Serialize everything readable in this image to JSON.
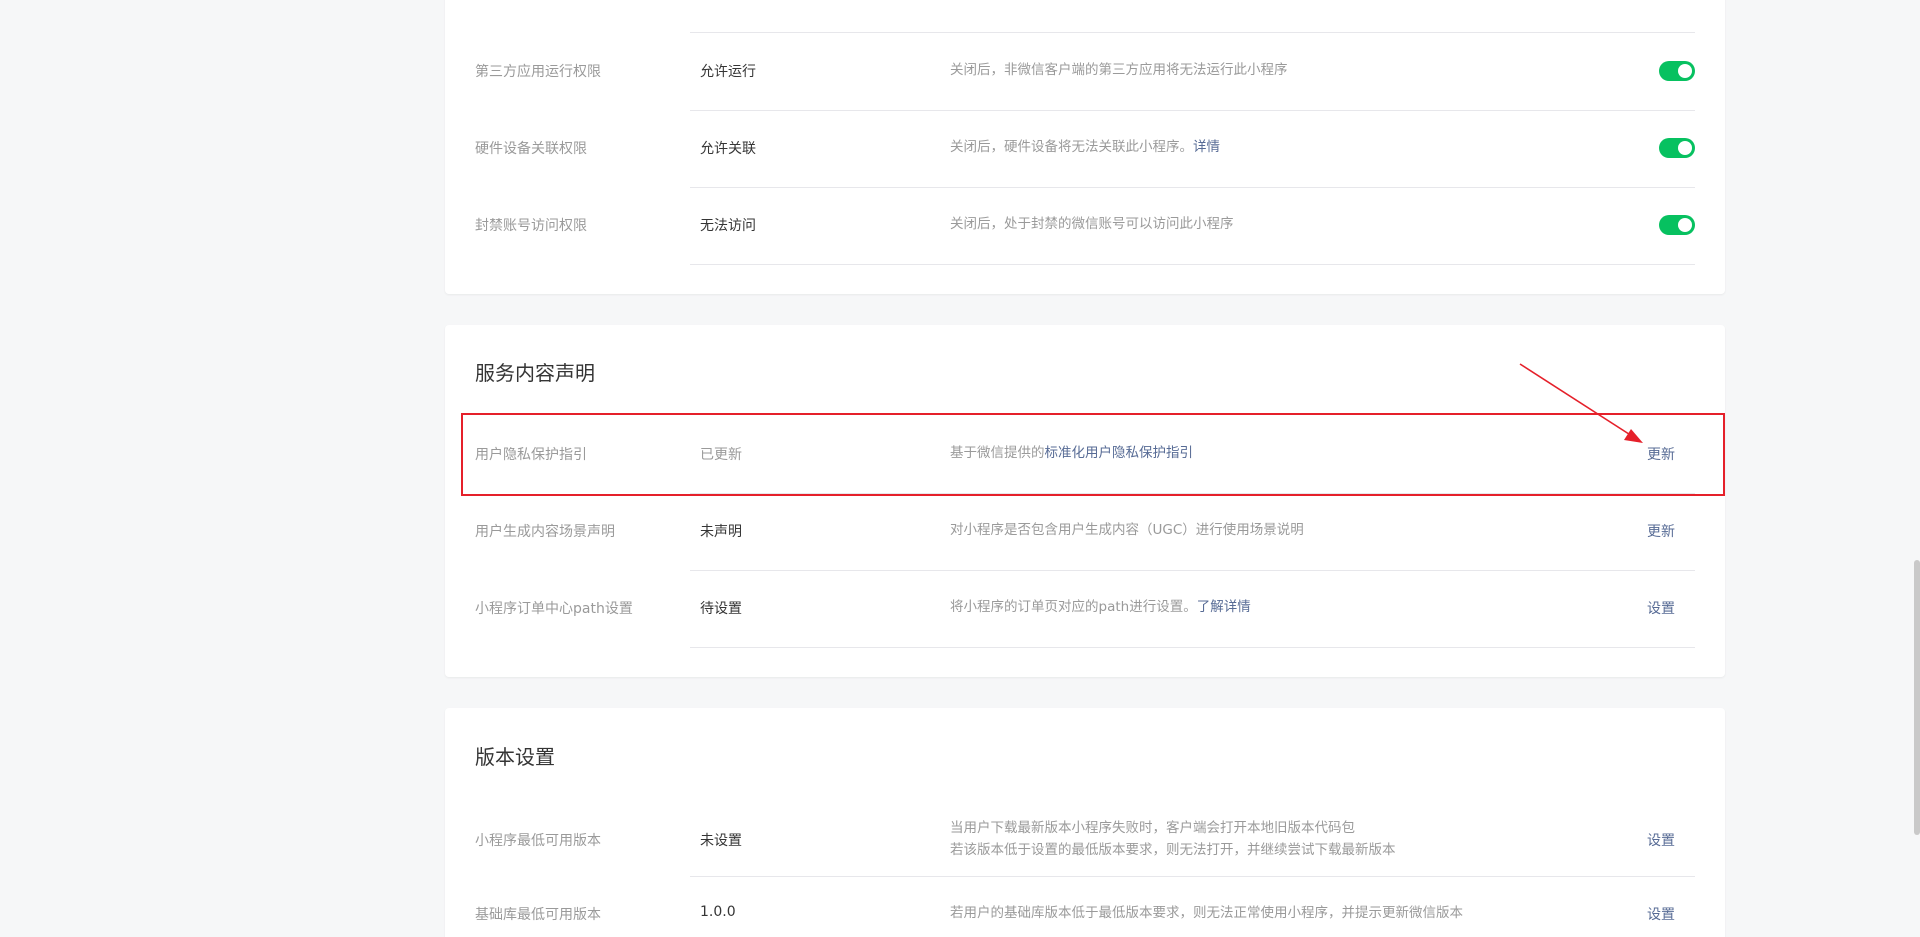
{
  "permissions_card": {
    "rows": [
      {
        "label": "第三方应用运行权限",
        "value": "允许运行",
        "desc": "关闭后，非微信客户端的第三方应用将无法运行此小程序",
        "desc_link": "",
        "toggle_on": true
      },
      {
        "label": "硬件设备关联权限",
        "value": "允许关联",
        "desc": "关闭后，硬件设备将无法关联此小程序。",
        "desc_link": "详情",
        "toggle_on": true
      },
      {
        "label": "封禁账号访问权限",
        "value": "无法访问",
        "desc": "关闭后，处于封禁的微信账号可以访问此小程序",
        "desc_link": "",
        "toggle_on": true
      }
    ]
  },
  "service_card": {
    "title": "服务内容声明",
    "rows": [
      {
        "label": "用户隐私保护指引",
        "value": "已更新",
        "desc": "基于微信提供的",
        "desc_link": "标准化用户隐私保护指引",
        "action": "更新"
      },
      {
        "label": "用户生成内容场景声明",
        "value": "未声明",
        "desc": "对小程序是否包含用户生成内容（UGC）进行使用场景说明",
        "desc_link": "",
        "action": "更新"
      },
      {
        "label": "小程序订单中心path设置",
        "value": "待设置",
        "desc": "将小程序的订单页对应的path进行设置。",
        "desc_link": "了解详情",
        "action": "设置"
      }
    ]
  },
  "version_card": {
    "title": "版本设置",
    "rows": [
      {
        "label": "小程序最低可用版本",
        "value": "未设置",
        "desc_line1": "当用户下载最新版本小程序失败时，客户端会打开本地旧版本代码包",
        "desc_line2": "若该版本低于设置的最低版本要求，则无法打开，并继续尝试下载最新版本",
        "action": "设置"
      },
      {
        "label": "基础库最低可用版本",
        "value": "1.0.0",
        "desc": "若用户的基础库版本低于最低版本要求，则无法正常使用小程序，并提示更新微信版本",
        "action": "设置"
      }
    ]
  },
  "colors": {
    "toggle_on": "#07c160",
    "link": "#576b95",
    "annotation": "#e5202a",
    "page_bg": "#f6f7f8"
  }
}
